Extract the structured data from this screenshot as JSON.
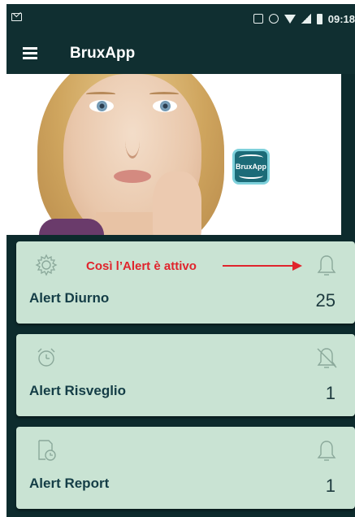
{
  "status_bar": {
    "time": "09:18"
  },
  "app_bar": {
    "title": "BruxApp",
    "menu_icon": "hamburger-menu-icon"
  },
  "header": {
    "logo_text": "BruxApp"
  },
  "cards": [
    {
      "label": "Alert Diurno",
      "value": "25",
      "left_icon": "gear-icon",
      "right_icon": "bell-icon",
      "annotation": "Così l’Alert è attivo"
    },
    {
      "label": "Alert Risveglio",
      "value": "1",
      "left_icon": "alarm-clock-icon",
      "right_icon": "bell-off-icon"
    },
    {
      "label": "Alert Report",
      "value": "1",
      "left_icon": "report-clock-icon",
      "right_icon": "bell-icon"
    }
  ],
  "colors": {
    "bar_bg": "#102f31",
    "card_bg": "#c9e3d3",
    "annotation": "#e0242c",
    "screen_bg": "#0d2b2d"
  }
}
